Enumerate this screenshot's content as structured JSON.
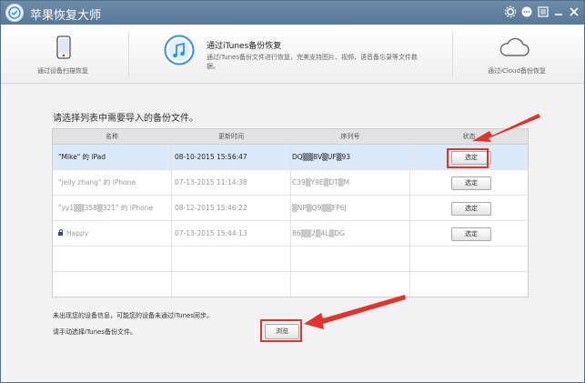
{
  "window": {
    "title": "苹果恢复大师"
  },
  "modes": {
    "device_scan": {
      "label": "通过设备扫描恢复"
    },
    "itunes": {
      "title": "通过iTunes备份恢复",
      "desc": "通过iTunes备份文件进行恢复，完美支持图片、视频、语音备忘录等文件数据。"
    },
    "icloud": {
      "label": "通过iCloud备份恢复"
    }
  },
  "prompt": "请选择列表中需要导入的备份文件。",
  "table": {
    "headers": {
      "name": "名称",
      "time": "更新时间",
      "serial": "序列号",
      "status": "状态"
    },
    "rows": [
      {
        "name": "\"Mike\" 的 iPad",
        "time": "08-10-2015 15:56:47",
        "serial": "DQ▒▒8V▒UF▒93",
        "button": "选定"
      },
      {
        "name": "\"jeily zhang\" 的 iPhone",
        "time": "07-13-2015 11:14:38",
        "serial": "C39▒Y9E▒DT▒M",
        "button": "选定"
      },
      {
        "name": "\"yy1▒▒358▒321\" 的 iPhone",
        "time": "08-12-2015 15:46:22",
        "serial": "▒NP▒Q9▒▒FP6J",
        "button": "选定"
      },
      {
        "name": "Happy",
        "time": "07-13-2015 15:44:13",
        "serial": "86▒▒2▒4L▒DG",
        "button": "选定"
      }
    ]
  },
  "notes": {
    "line1": "未出现您的设备信息，可能您的设备未通过iTunes同步。",
    "line2": "请手动选择iTunes备份文件。",
    "browse": "浏览"
  },
  "colors": {
    "titlebar": "#58789a",
    "accent": "#3a8ee6",
    "highlight": "#e0342c",
    "selected_row": "#dbe9f8"
  }
}
